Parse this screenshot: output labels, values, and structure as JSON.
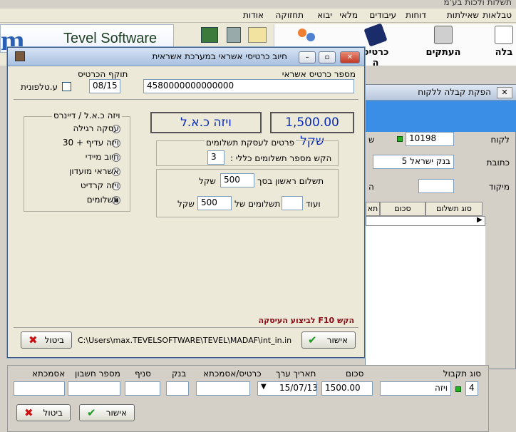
{
  "top_strip": "תשלות ולכות בע'מ",
  "menu": [
    "טבלאות",
    "שאילתות",
    "דוחות",
    "עיבודים",
    "מלאי",
    "יבוא",
    "תחזוקה",
    "אודות"
  ],
  "logo": {
    "brand": "Tevel Software",
    "mark": "m"
  },
  "toolbar": {
    "btn_receipt": "בלה",
    "btn_copies": "העתקים",
    "btn_card": "כרטיס ה"
  },
  "receipt_window": {
    "title": "הפקת קבלה ללקוח",
    "customer_label": "לקוח",
    "customer_value": "10198",
    "address_label": "כתובת",
    "address_value": "בנק ישראל 5",
    "zip_label": "מיקוד",
    "zip_value": "",
    "side_label_1": "ש",
    "side_label_2": "ה",
    "grid_headers": [
      "סוג תשלום",
      "סכום",
      "תא"
    ]
  },
  "dialog": {
    "title": "חיוב כרטיסי אשראי במערכת אשראית",
    "card_number_label": "מספר כרטיס אשראי",
    "card_number_value": "4580000000000000",
    "expiry_label": "תוקף הכרטיס",
    "expiry_value": "08/15",
    "phone_checkbox_label": "ע.טלפונית",
    "amount_display": "1,500.00 שקל",
    "card_type_display": "ויזה כ.א.ל",
    "installments_group_title": "פרטים לעסקת תשלומים",
    "installments_prompt": "הקש מספר תשלומים כללי :",
    "installments_value": "3",
    "first_payment_label": "תשלום ראשון בסך",
    "first_payment_value": "500",
    "first_payment_unit": "שקל",
    "more_label": "ועוד",
    "more_count_value": "",
    "payments_of_label": "תשלומים של",
    "payments_of_value": "500",
    "payments_of_unit": "שקל",
    "transaction_group_title": "ויזה כ.א.ל / דיינרס",
    "options": [
      "עסקה רגילה",
      "ויזה עדיף + 30",
      "חיוב מיידי",
      "אשראי מועדון",
      "ויזה קרדיט",
      "תשלומים"
    ],
    "selected_option": 5,
    "f10_hint": "הקש F10 לביצוע העיסקה",
    "path": "C:\\Users\\max.TEVELSOFTWARE\\TEVEL\\MADAF\\int_in.in",
    "ok_label": "אישור",
    "cancel_label": "ביטול"
  },
  "bottom": {
    "receipt_type_label": "סוג תקבול",
    "receipt_type_code": "4",
    "receipt_type_name": "ויזה",
    "amount_label": "סכום",
    "amount_value": "1500.00",
    "date_label": "תאריך ערך",
    "date_value": "15/07/13",
    "card_ref_label": "כרטיס/אסמכתא",
    "card_ref_value": "",
    "bank_label": "בנק",
    "bank_value": "",
    "branch_label": "סניף",
    "branch_value": "",
    "account_label": "מספר חשבון",
    "account_value": "",
    "reference_label": "אסמכתא",
    "reference_value": "",
    "ok_label": "אישור",
    "cancel_label": "ביטול"
  },
  "colors": {
    "title_blue": "#0a2bb8",
    "hint_red": "#8b0a14",
    "accent_green": "#22b022",
    "panel_blue": "#3b8ee6"
  }
}
